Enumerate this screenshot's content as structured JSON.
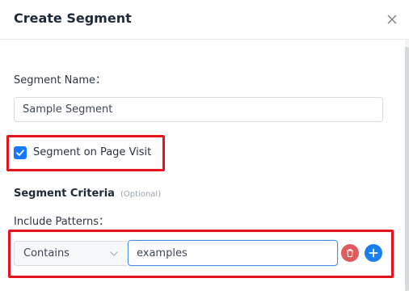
{
  "dialog": {
    "title": "Create Segment",
    "close_icon": "close-icon"
  },
  "form": {
    "segment_name_label": "Segment Name：",
    "segment_name_value": "Sample Segment",
    "page_visit_checkbox": {
      "label": "Segment on Page Visit",
      "checked": true
    },
    "criteria_title": "Segment Criteria",
    "criteria_optional": "(Optional)",
    "include_patterns_label": "Include Patterns：",
    "pattern_row": {
      "match_type": "Contains",
      "value": "examples",
      "delete_icon": "trash-icon",
      "add_icon": "plus-icon"
    }
  },
  "colors": {
    "accent": "#1677ff",
    "highlight_box": "#e8121c",
    "delete_button": "#e05b5b",
    "add_button": "#1b7ff0"
  }
}
